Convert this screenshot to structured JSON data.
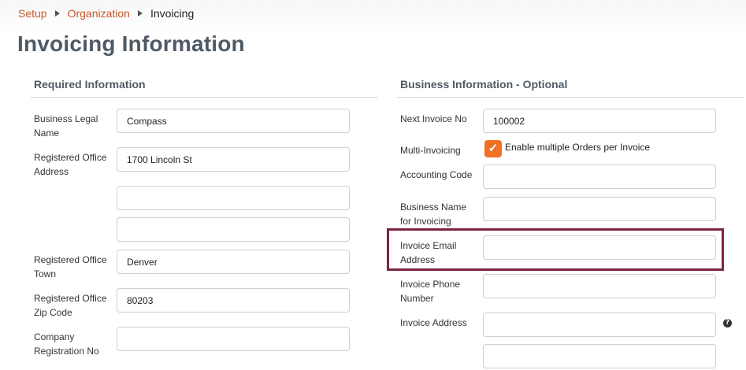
{
  "breadcrumb": {
    "items": [
      "Setup",
      "Organization"
    ],
    "current": "Invoicing"
  },
  "page": {
    "title": "Invoicing Information"
  },
  "required": {
    "title": "Required Information",
    "business_legal_name": {
      "label": "Business Legal Name",
      "value": "Compass"
    },
    "registered_office_address": {
      "label": "Registered Office Address",
      "line1": "1700 Lincoln St",
      "line2": "",
      "line3": ""
    },
    "registered_office_town": {
      "label": "Registered Office Town",
      "value": "Denver"
    },
    "registered_office_zip": {
      "label": "Registered Office Zip Code",
      "value": "80203"
    },
    "company_registration_no": {
      "label": "Company Registration No",
      "value": ""
    }
  },
  "optional": {
    "title": "Business Information - Optional",
    "next_invoice_no": {
      "label": "Next Invoice No",
      "value": "100002"
    },
    "multi_invoicing": {
      "label": "Multi-Invoicing",
      "checkbox_label": "Enable multiple Orders per Invoice",
      "checked": true
    },
    "accounting_code": {
      "label": "Accounting Code",
      "value": ""
    },
    "business_name_for_invoicing": {
      "label": "Business Name for Invoicing",
      "value": ""
    },
    "invoice_email_address": {
      "label": "Invoice Email Address",
      "value": ""
    },
    "invoice_phone_number": {
      "label": "Invoice Phone Number",
      "value": ""
    },
    "invoice_address": {
      "label": "Invoice Address",
      "line1": "",
      "line2": ""
    }
  },
  "icons": {
    "help": "question-circle-icon",
    "checkmark": "checkmark-icon",
    "breadcrumb_separator": "triangle-right-icon"
  },
  "colors": {
    "accent": "#f07025",
    "link": "#c8582a",
    "heading": "#4f5a65",
    "highlight": "#7a2445"
  }
}
